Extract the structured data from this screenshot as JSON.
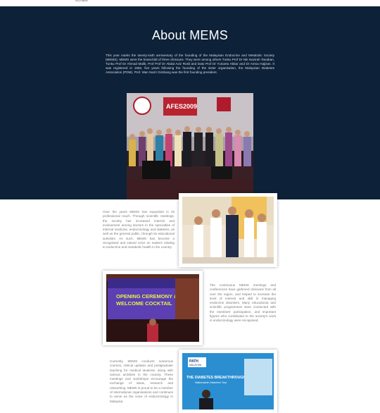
{
  "breadcrumb": "About MEMS",
  "page": {
    "title": "About MEMS",
    "intro": "This year marks the twenty-sixth anniversary of the founding of the Malaysian Endocrine and Metabolic Society (MEMS). MEMS were the brainchild of three clinicians. They were among others Tunku Prof Dr Nik Nazirah Tanaban, Tunku Prof Dr Ahmad Malik, Prof Prof Dr Abdul Aziz Rosli and Dato Prof Dr Yuniarto Akbar and Dr Amna Hajizan. It was registered in 1982, five years following the founding of the sister organisation, the Malaysian Diabetes Association (PDM). Prof. Wan Nazri Gimbang was the first founding president.",
    "para1": "Over the years MEMS has expanded in its professional reach. Through scientific meetings, the society has increased interest and involvement among doctors in the specialties of internal medicine, endocrinology and diabetes, as well as the general public, through its educational activities. As such, MEMS has become a recognised and valued voice on matters relating to endocrine and metabolic health in the country.",
    "para2": "The continuous MEMS meetings and conferences have gathered clinicians from all over the region, and helped to increase the level of interest and skill in managing endocrine disorders. Many educational and scientific programmes were conducted with the members' participation, and important figures who contributed to the society's work in endocrinology were recognised.",
    "para3": "Currently, MEMS conducts numerous courses, clinical updates and postgraduate teaching for medical students, along with various activities in the country. These meetings and workshops encourage the exchange of ideas, research and networking. MEMS is proud to be a member of international organisations and continues to serve as the voice of endocrinology in Malaysia."
  },
  "photos": {
    "main_banner_left": "AFES2009",
    "r3_banner_top": "PATH",
    "r3_banner_mid": "MALAYSIA",
    "r3_banner_title": "THE DIABETES BREAKTHROUGH",
    "r3_banner_sub": "Nationwide Diabetes Tour",
    "l2_screen_line1": "OPENING CEREMONY &",
    "l2_screen_line2": "WELCOME COCKTAIL"
  },
  "colors": {
    "navy": "#0d2138",
    "white": "#ffffff",
    "body_text": "#7a7a7a"
  }
}
